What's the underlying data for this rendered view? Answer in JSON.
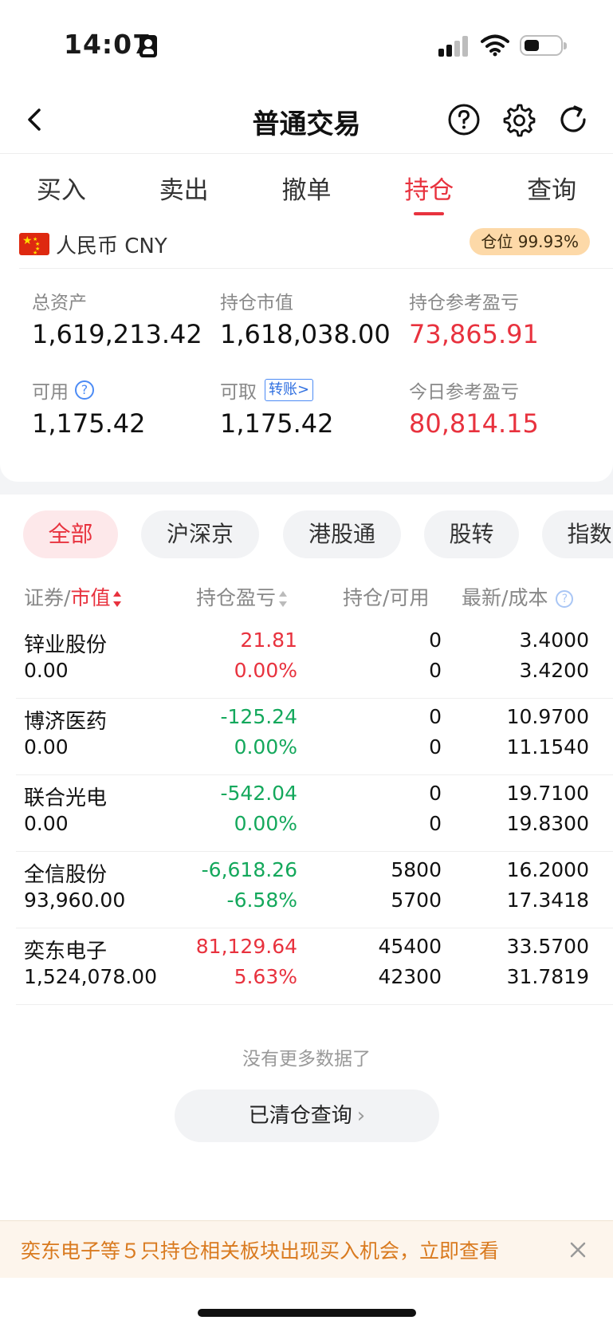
{
  "status_bar": {
    "time": "14:07"
  },
  "nav": {
    "title": "普通交易"
  },
  "tabs": [
    {
      "label": "买入",
      "active": false
    },
    {
      "label": "卖出",
      "active": false
    },
    {
      "label": "撤单",
      "active": false
    },
    {
      "label": "持仓",
      "active": true
    },
    {
      "label": "查询",
      "active": false
    }
  ],
  "account": {
    "currency": "人民币 CNY",
    "position_badge": "仓位 99.93%",
    "total_assets_label": "总资产",
    "total_assets": "1,619,213.42",
    "market_value_label": "持仓市值",
    "market_value": "1,618,038.00",
    "position_pl_label": "持仓参考盈亏",
    "position_pl": "73,865.91",
    "available_label": "可用",
    "available": "1,175.42",
    "withdrawable_label": "可取",
    "transfer_label": "转账>",
    "withdrawable": "1,175.42",
    "today_pl_label": "今日参考盈亏",
    "today_pl": "80,814.15"
  },
  "filters": [
    {
      "label": "全部",
      "active": true
    },
    {
      "label": "沪深京",
      "active": false
    },
    {
      "label": "港股通",
      "active": false
    },
    {
      "label": "股转",
      "active": false
    },
    {
      "label": "指数",
      "active": false
    }
  ],
  "table": {
    "col_security": "证券",
    "col_market_value": "市值",
    "col_pl": "持仓盈亏",
    "col_position": "持仓",
    "col_available": "可用",
    "col_last": "最新",
    "col_cost": "成本",
    "sep": "/",
    "rows": [
      {
        "name": "锌业股份",
        "market_value": "0.00",
        "pl": "21.81",
        "pl_pct": "0.00%",
        "position": "0",
        "available": "0",
        "last": "3.4000",
        "cost": "3.4200",
        "trend": "up"
      },
      {
        "name": "博济医药",
        "market_value": "0.00",
        "pl": "-125.24",
        "pl_pct": "0.00%",
        "position": "0",
        "available": "0",
        "last": "10.9700",
        "cost": "11.1540",
        "trend": "down"
      },
      {
        "name": "联合光电",
        "market_value": "0.00",
        "pl": "-542.04",
        "pl_pct": "0.00%",
        "position": "0",
        "available": "0",
        "last": "19.7100",
        "cost": "19.8300",
        "trend": "down"
      },
      {
        "name": "全信股份",
        "market_value": "93,960.00",
        "pl": "-6,618.26",
        "pl_pct": "-6.58%",
        "position": "5800",
        "available": "5700",
        "last": "16.2000",
        "cost": "17.3418",
        "trend": "down"
      },
      {
        "name": "奕东电子",
        "market_value": "1,524,078.00",
        "pl": "81,129.64",
        "pl_pct": "5.63%",
        "position": "45400",
        "available": "42300",
        "last": "33.5700",
        "cost": "31.7819",
        "trend": "up"
      }
    ]
  },
  "no_more": "没有更多数据了",
  "cleared_button": "已清仓查询",
  "banner": "奕东电子等５只持仓相关板块出现买入机会，立即查看",
  "colors": {
    "accent_red": "#e8323e",
    "down_green": "#14a85c",
    "banner_orange": "#d97a1f",
    "link_blue": "#4c8bf5"
  }
}
